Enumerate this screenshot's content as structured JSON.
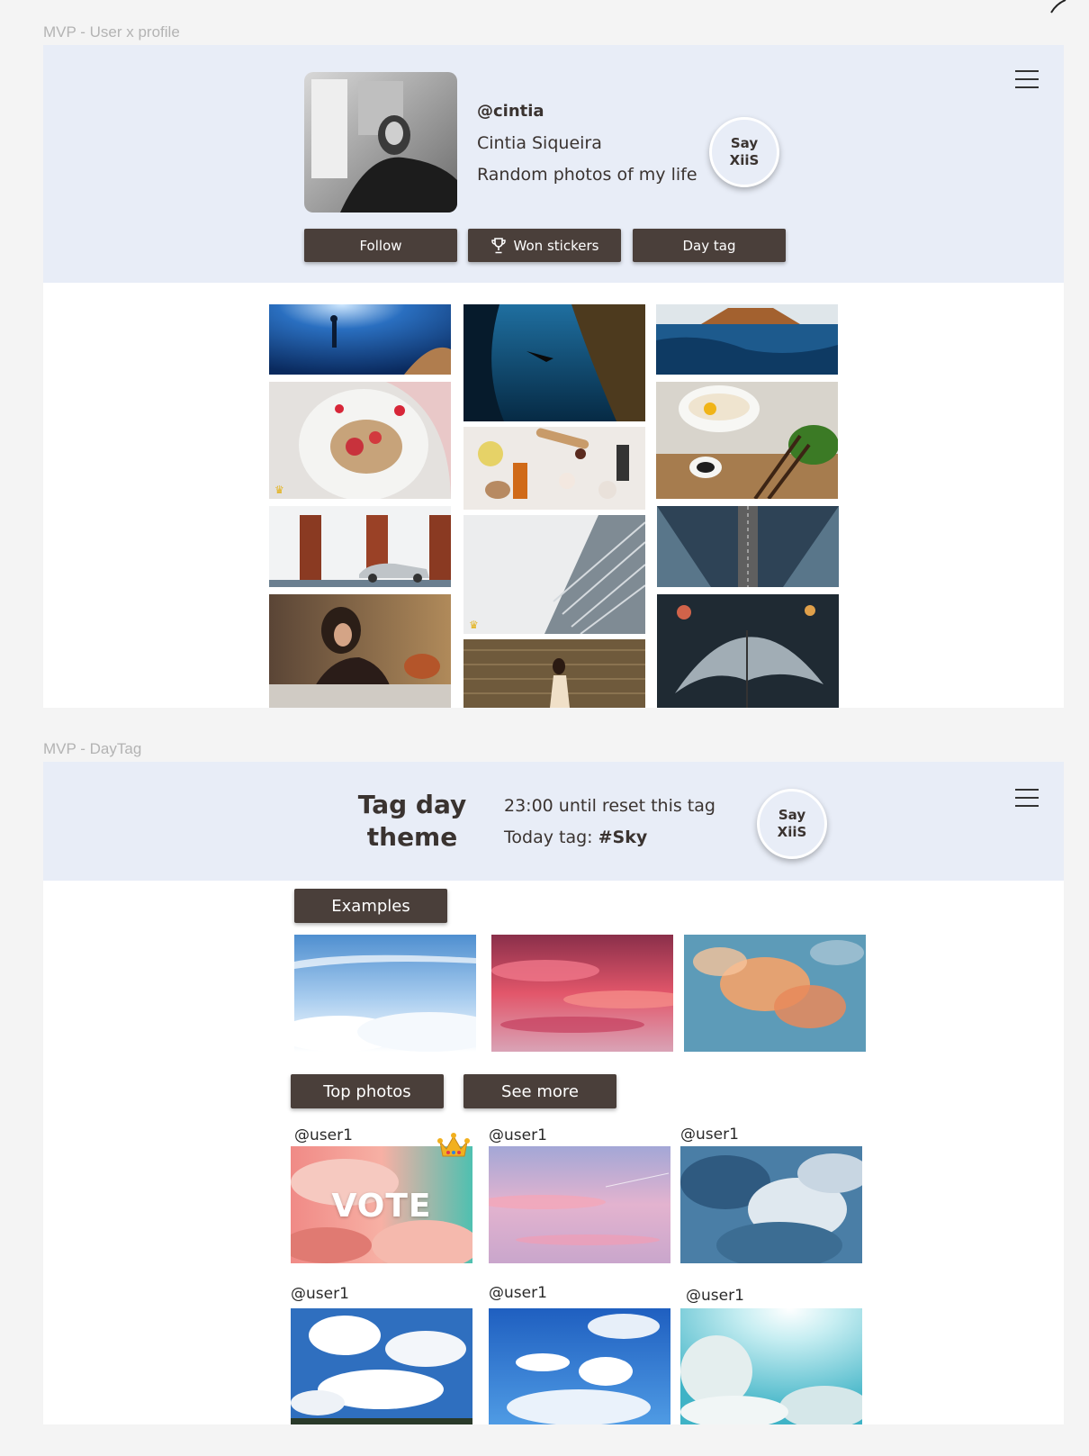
{
  "profile_frame": {
    "label": "MVP -  User x profile",
    "handle": "@cintia",
    "name": "Cintia Siqueira",
    "bio": "Random photos of my life",
    "say_button": "Say XiiS",
    "buttons": {
      "follow": "Follow",
      "won_stickers": "Won stickers",
      "day_tag": "Day tag"
    },
    "gallery_photos": [
      "freediver in deep blue ocean",
      "plate of strawberries and granola",
      "white building with red doors and silver car",
      "woman with curly hair sitting on bed",
      "diver descending between underwater rocks",
      "skincare bottles and crystals flat lay",
      "glass skyscraper looking up",
      "woman walking beside stone wall at sunset",
      "split view island above and ocean below",
      "bowl of noodles with egg and chopsticks",
      "aerial view of road and bridge",
      "transparent umbrella in the rain"
    ]
  },
  "daytag_frame": {
    "label": "MVP -  DayTag",
    "title": "Tag day theme",
    "reset_text": "23:00 until reset this tag",
    "today_prefix": "Today tag: ",
    "today_tag": "#Sky",
    "say_button": "Say XiiS",
    "examples_label": "Examples",
    "example_photos": [
      "blue sky above clouds",
      "pink and red sunset clouds",
      "orange clouds on blue sky"
    ],
    "top_photos_label": "Top photos",
    "see_more_label": "See more",
    "vote_label": "VOTE",
    "top_photos": [
      {
        "user": "@user1",
        "desc": "pink clouds on teal sky",
        "crown": true
      },
      {
        "user": "@user1",
        "desc": "pastel pink sky",
        "crown": false
      },
      {
        "user": "@user1",
        "desc": "blue storm clouds",
        "crown": false
      },
      {
        "user": "@user1",
        "desc": "white clouds on blue sky with trees",
        "crown": false
      },
      {
        "user": "@user1",
        "desc": "scattered white clouds on blue sky",
        "crown": false
      },
      {
        "user": "@user1",
        "desc": "bright sun with clouds",
        "crown": false
      }
    ]
  },
  "icons": [
    "menu-icon",
    "trophy-icon",
    "crown-icon"
  ],
  "colors": {
    "header_band": "#e8edf7",
    "button_dark": "#4a3f3a",
    "text_dark": "#3a3330",
    "page_bg": "#f4f4f4"
  }
}
